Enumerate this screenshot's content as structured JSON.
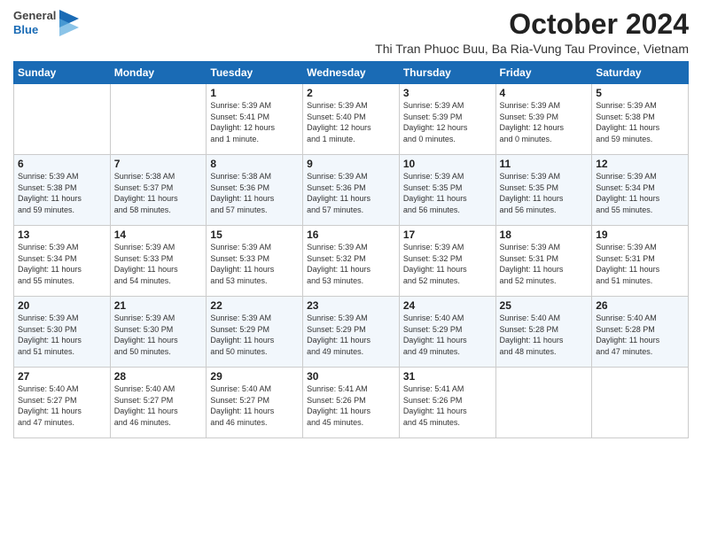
{
  "logo": {
    "general": "General",
    "blue": "Blue"
  },
  "title": "October 2024",
  "subtitle": "Thi Tran Phuoc Buu, Ba Ria-Vung Tau Province, Vietnam",
  "days_of_week": [
    "Sunday",
    "Monday",
    "Tuesday",
    "Wednesday",
    "Thursday",
    "Friday",
    "Saturday"
  ],
  "weeks": [
    [
      {
        "day": "",
        "info": ""
      },
      {
        "day": "",
        "info": ""
      },
      {
        "day": "1",
        "info": "Sunrise: 5:39 AM\nSunset: 5:41 PM\nDaylight: 12 hours\nand 1 minute."
      },
      {
        "day": "2",
        "info": "Sunrise: 5:39 AM\nSunset: 5:40 PM\nDaylight: 12 hours\nand 1 minute."
      },
      {
        "day": "3",
        "info": "Sunrise: 5:39 AM\nSunset: 5:39 PM\nDaylight: 12 hours\nand 0 minutes."
      },
      {
        "day": "4",
        "info": "Sunrise: 5:39 AM\nSunset: 5:39 PM\nDaylight: 12 hours\nand 0 minutes."
      },
      {
        "day": "5",
        "info": "Sunrise: 5:39 AM\nSunset: 5:38 PM\nDaylight: 11 hours\nand 59 minutes."
      }
    ],
    [
      {
        "day": "6",
        "info": "Sunrise: 5:39 AM\nSunset: 5:38 PM\nDaylight: 11 hours\nand 59 minutes."
      },
      {
        "day": "7",
        "info": "Sunrise: 5:38 AM\nSunset: 5:37 PM\nDaylight: 11 hours\nand 58 minutes."
      },
      {
        "day": "8",
        "info": "Sunrise: 5:38 AM\nSunset: 5:36 PM\nDaylight: 11 hours\nand 57 minutes."
      },
      {
        "day": "9",
        "info": "Sunrise: 5:39 AM\nSunset: 5:36 PM\nDaylight: 11 hours\nand 57 minutes."
      },
      {
        "day": "10",
        "info": "Sunrise: 5:39 AM\nSunset: 5:35 PM\nDaylight: 11 hours\nand 56 minutes."
      },
      {
        "day": "11",
        "info": "Sunrise: 5:39 AM\nSunset: 5:35 PM\nDaylight: 11 hours\nand 56 minutes."
      },
      {
        "day": "12",
        "info": "Sunrise: 5:39 AM\nSunset: 5:34 PM\nDaylight: 11 hours\nand 55 minutes."
      }
    ],
    [
      {
        "day": "13",
        "info": "Sunrise: 5:39 AM\nSunset: 5:34 PM\nDaylight: 11 hours\nand 55 minutes."
      },
      {
        "day": "14",
        "info": "Sunrise: 5:39 AM\nSunset: 5:33 PM\nDaylight: 11 hours\nand 54 minutes."
      },
      {
        "day": "15",
        "info": "Sunrise: 5:39 AM\nSunset: 5:33 PM\nDaylight: 11 hours\nand 53 minutes."
      },
      {
        "day": "16",
        "info": "Sunrise: 5:39 AM\nSunset: 5:32 PM\nDaylight: 11 hours\nand 53 minutes."
      },
      {
        "day": "17",
        "info": "Sunrise: 5:39 AM\nSunset: 5:32 PM\nDaylight: 11 hours\nand 52 minutes."
      },
      {
        "day": "18",
        "info": "Sunrise: 5:39 AM\nSunset: 5:31 PM\nDaylight: 11 hours\nand 52 minutes."
      },
      {
        "day": "19",
        "info": "Sunrise: 5:39 AM\nSunset: 5:31 PM\nDaylight: 11 hours\nand 51 minutes."
      }
    ],
    [
      {
        "day": "20",
        "info": "Sunrise: 5:39 AM\nSunset: 5:30 PM\nDaylight: 11 hours\nand 51 minutes."
      },
      {
        "day": "21",
        "info": "Sunrise: 5:39 AM\nSunset: 5:30 PM\nDaylight: 11 hours\nand 50 minutes."
      },
      {
        "day": "22",
        "info": "Sunrise: 5:39 AM\nSunset: 5:29 PM\nDaylight: 11 hours\nand 50 minutes."
      },
      {
        "day": "23",
        "info": "Sunrise: 5:39 AM\nSunset: 5:29 PM\nDaylight: 11 hours\nand 49 minutes."
      },
      {
        "day": "24",
        "info": "Sunrise: 5:40 AM\nSunset: 5:29 PM\nDaylight: 11 hours\nand 49 minutes."
      },
      {
        "day": "25",
        "info": "Sunrise: 5:40 AM\nSunset: 5:28 PM\nDaylight: 11 hours\nand 48 minutes."
      },
      {
        "day": "26",
        "info": "Sunrise: 5:40 AM\nSunset: 5:28 PM\nDaylight: 11 hours\nand 47 minutes."
      }
    ],
    [
      {
        "day": "27",
        "info": "Sunrise: 5:40 AM\nSunset: 5:27 PM\nDaylight: 11 hours\nand 47 minutes."
      },
      {
        "day": "28",
        "info": "Sunrise: 5:40 AM\nSunset: 5:27 PM\nDaylight: 11 hours\nand 46 minutes."
      },
      {
        "day": "29",
        "info": "Sunrise: 5:40 AM\nSunset: 5:27 PM\nDaylight: 11 hours\nand 46 minutes."
      },
      {
        "day": "30",
        "info": "Sunrise: 5:41 AM\nSunset: 5:26 PM\nDaylight: 11 hours\nand 45 minutes."
      },
      {
        "day": "31",
        "info": "Sunrise: 5:41 AM\nSunset: 5:26 PM\nDaylight: 11 hours\nand 45 minutes."
      },
      {
        "day": "",
        "info": ""
      },
      {
        "day": "",
        "info": ""
      }
    ]
  ]
}
